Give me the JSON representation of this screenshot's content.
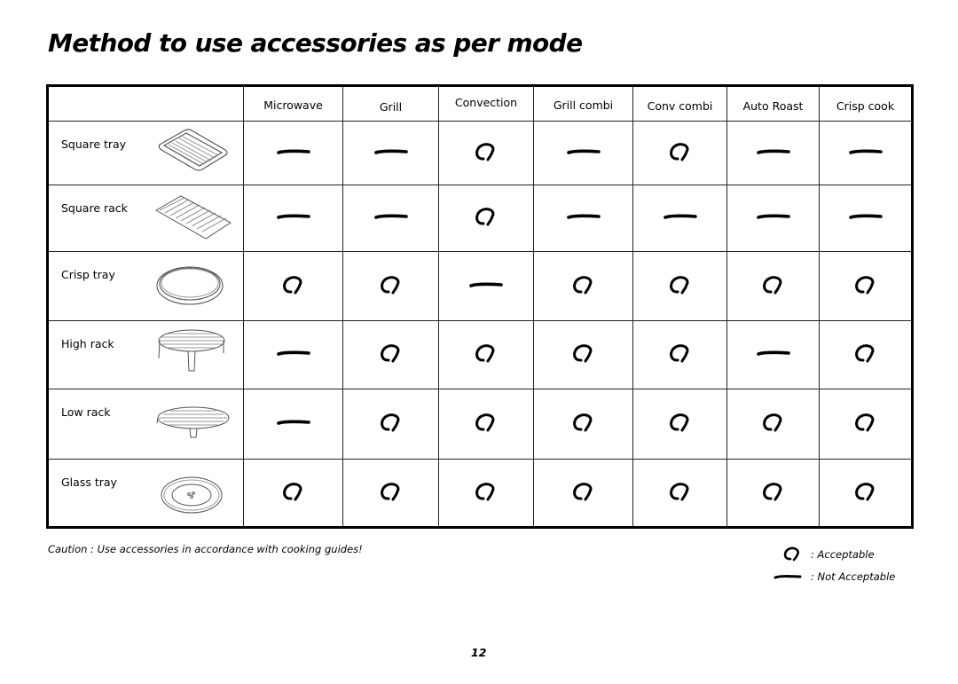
{
  "page": {
    "title": "Method to use accessories as per mode",
    "page_number": "12"
  },
  "table": {
    "columns": [
      "Microwave",
      "Grill",
      "Convection",
      "Grill combi",
      "Conv combi",
      "Auto Roast",
      "Crisp cook"
    ],
    "rows": [
      {
        "accessory": "Square tray",
        "icon": "square-tray-icon",
        "values": [
          "not_acceptable",
          "not_acceptable",
          "acceptable",
          "not_acceptable",
          "acceptable",
          "not_acceptable",
          "not_acceptable"
        ]
      },
      {
        "accessory": "Square rack",
        "icon": "square-rack-icon",
        "values": [
          "not_acceptable",
          "not_acceptable",
          "acceptable",
          "not_acceptable",
          "not_acceptable",
          "not_acceptable",
          "not_acceptable"
        ]
      },
      {
        "accessory": "Crisp tray",
        "icon": "crisp-tray-icon",
        "values": [
          "acceptable",
          "acceptable",
          "not_acceptable",
          "acceptable",
          "acceptable",
          "acceptable",
          "acceptable"
        ]
      },
      {
        "accessory": "High rack",
        "icon": "high-rack-icon",
        "values": [
          "not_acceptable",
          "acceptable",
          "acceptable",
          "acceptable",
          "acceptable",
          "not_acceptable",
          "acceptable"
        ]
      },
      {
        "accessory": "Low rack",
        "icon": "low-rack-icon",
        "values": [
          "not_acceptable",
          "acceptable",
          "acceptable",
          "acceptable",
          "acceptable",
          "acceptable",
          "acceptable"
        ]
      },
      {
        "accessory": "Glass tray",
        "icon": "glass-tray-icon",
        "values": [
          "acceptable",
          "acceptable",
          "acceptable",
          "acceptable",
          "acceptable",
          "acceptable",
          "acceptable"
        ]
      }
    ]
  },
  "caution": "Caution : Use accessories in accordance with cooking guides!",
  "legend": {
    "acceptable": ": Acceptable",
    "not_acceptable": ": Not Acceptable"
  }
}
